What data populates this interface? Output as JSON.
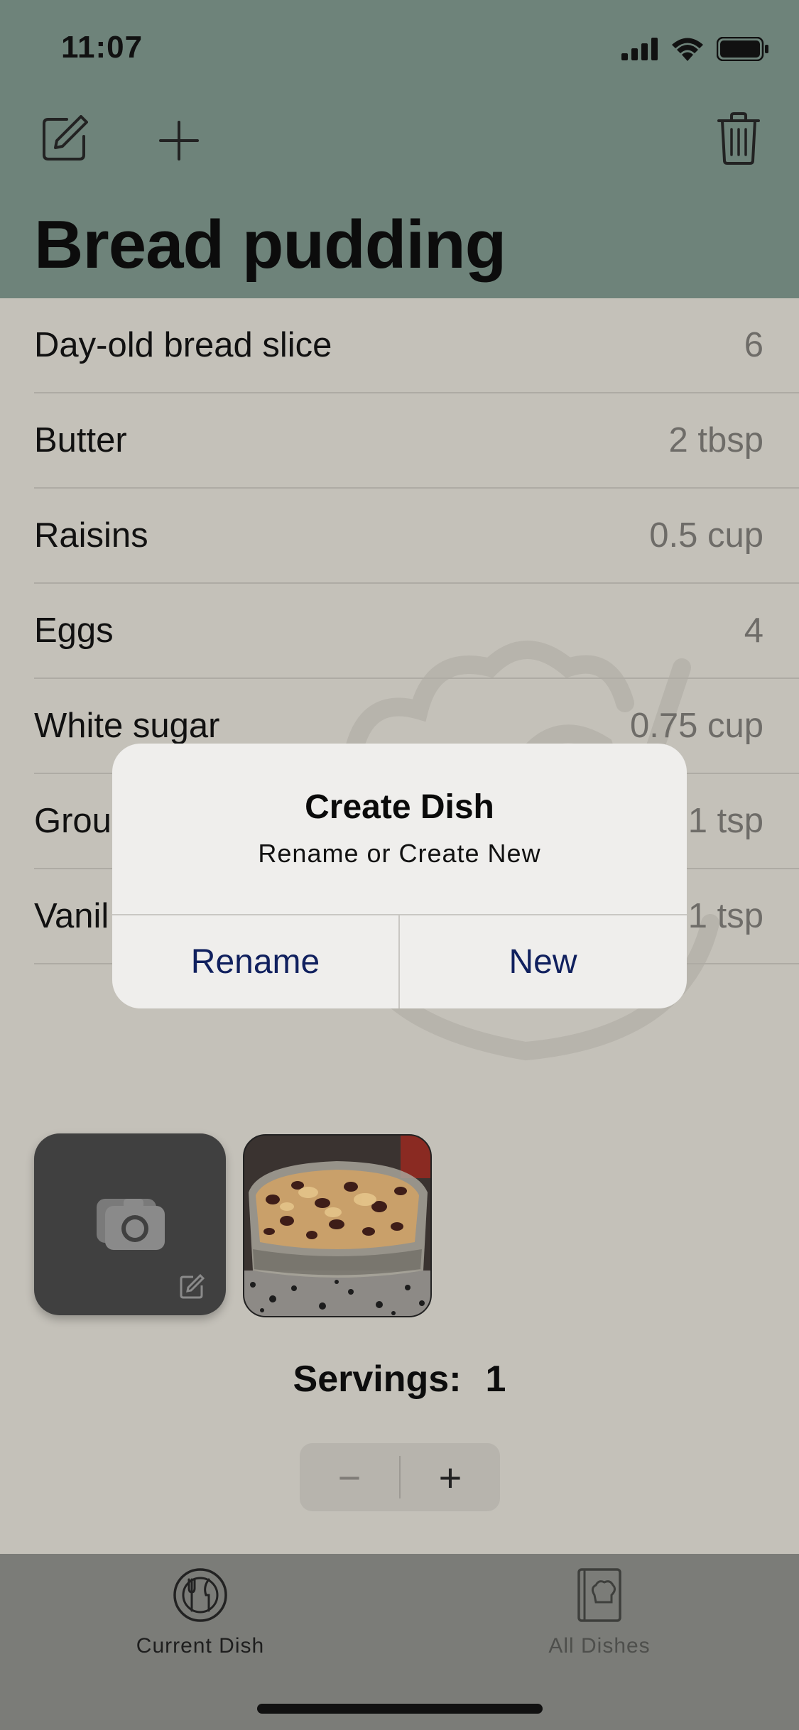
{
  "status_bar": {
    "time": "11:07"
  },
  "header": {
    "title": "Bread pudding",
    "icons": [
      "edit-icon",
      "plus-icon",
      "trash-icon"
    ]
  },
  "ingredients": [
    {
      "name": "Day-old bread slice",
      "qty": "6"
    },
    {
      "name": "Butter",
      "qty": "2 tbsp"
    },
    {
      "name": "Raisins",
      "qty": "0.5 cup"
    },
    {
      "name": "Eggs",
      "qty": "4"
    },
    {
      "name": "White sugar",
      "qty": "0.75 cup"
    },
    {
      "name": "Grou",
      "qty": "1 tsp"
    },
    {
      "name": "Vanil",
      "qty": "1 tsp"
    }
  ],
  "servings": {
    "label": "Servings:",
    "value": "1"
  },
  "stepper": {
    "minus": "−",
    "plus": "+"
  },
  "tabs": [
    {
      "label": "Current Dish",
      "icon": "plate-cutlery-icon",
      "active": true
    },
    {
      "label": "All Dishes",
      "icon": "cookbook-icon",
      "active": false
    }
  ],
  "alert": {
    "title": "Create Dish",
    "message": "Rename or Create New",
    "buttons": [
      "Rename",
      "New"
    ]
  },
  "colors": {
    "header_bg": "#6e837a",
    "content_bg": "#c4c1b9",
    "alert_button": "#10205e",
    "tabbar_bg": "#7b7c78"
  }
}
